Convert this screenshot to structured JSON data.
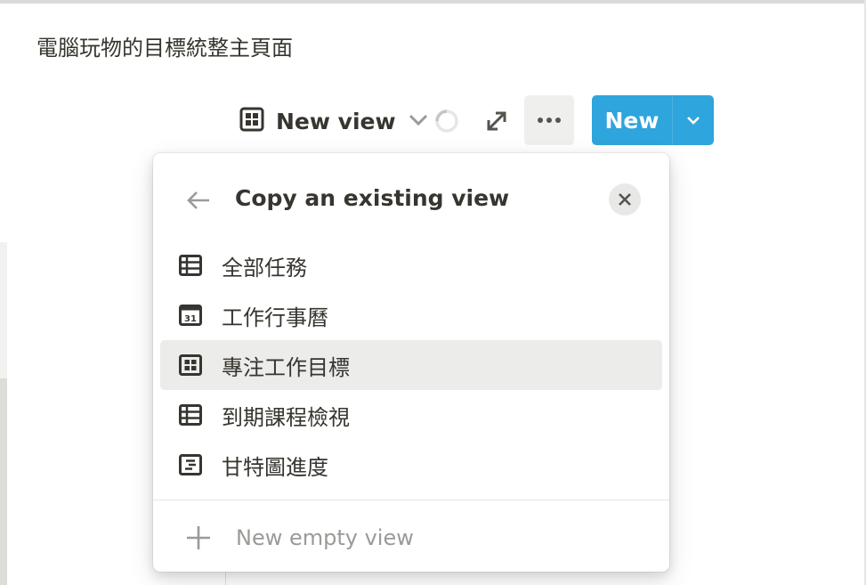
{
  "page": {
    "title": "電腦玩物的目標統整主頁面"
  },
  "toolbar": {
    "view_label": "New view",
    "new_label": "New"
  },
  "popup": {
    "title": "Copy an existing view",
    "views": [
      {
        "label": "全部任務",
        "icon": "table-icon"
      },
      {
        "label": "工作行事曆",
        "icon": "calendar-icon"
      },
      {
        "label": "專注工作目標",
        "icon": "board-icon"
      },
      {
        "label": "到期課程檢視",
        "icon": "table-icon"
      },
      {
        "label": "甘特圖進度",
        "icon": "timeline-icon"
      }
    ],
    "empty_view_label": "New empty view"
  },
  "colors": {
    "accent": "#2ea5dc",
    "highlight": "#ececeb"
  }
}
